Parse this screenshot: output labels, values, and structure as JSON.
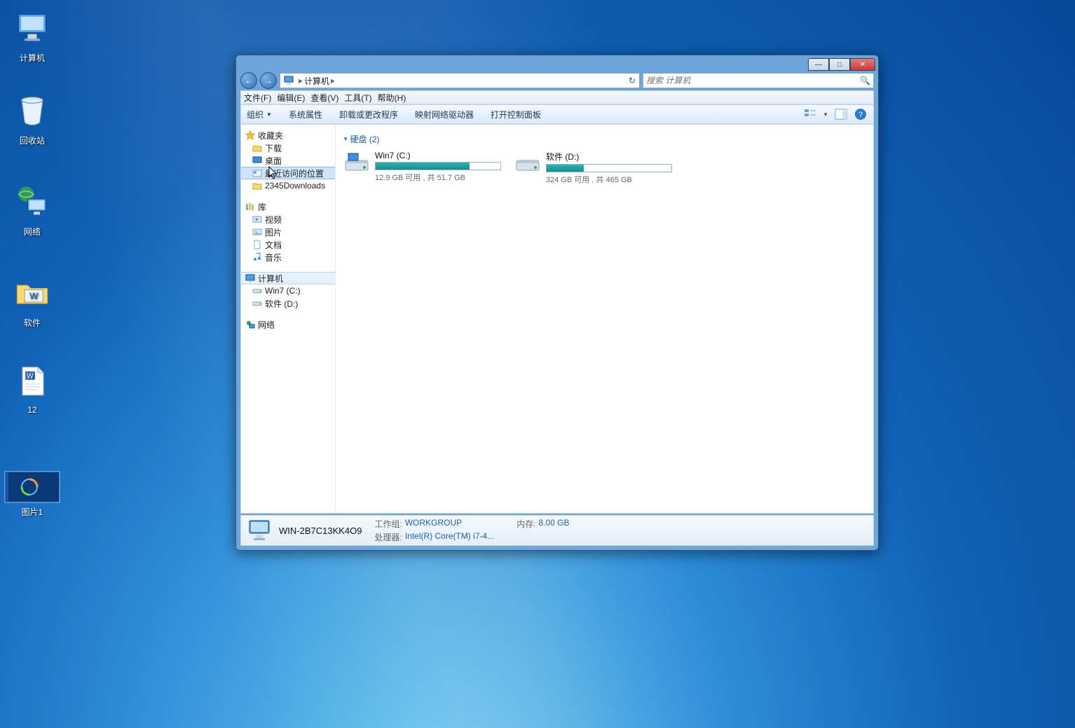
{
  "desktop_icons": [
    {
      "id": "computer",
      "label": "计算机"
    },
    {
      "id": "recycle",
      "label": "回收站"
    },
    {
      "id": "network",
      "label": "网络"
    },
    {
      "id": "software",
      "label": "软件"
    },
    {
      "id": "doc12",
      "label": "12"
    },
    {
      "id": "pic1",
      "label": "图片1"
    }
  ],
  "window": {
    "nav": {
      "back": "←",
      "forward": "→"
    },
    "breadcrumb": {
      "root_sep": "▸",
      "location": "计算机",
      "trail_sep": "▸"
    },
    "search_placeholder": "搜索 计算机",
    "menu": [
      "文件(F)",
      "编辑(E)",
      "查看(V)",
      "工具(T)",
      "帮助(H)"
    ],
    "toolbar": {
      "organize": "组织",
      "items": [
        "系统属性",
        "卸载或更改程序",
        "映射网络驱动器",
        "打开控制面板"
      ]
    },
    "sidebar": {
      "favorites": {
        "title": "收藏夹",
        "items": [
          "下载",
          "桌面",
          "最近访问的位置",
          "2345Downloads"
        ]
      },
      "libraries": {
        "title": "库",
        "items": [
          "视频",
          "图片",
          "文档",
          "音乐"
        ]
      },
      "computer": {
        "title": "计算机",
        "items": [
          "Win7 (C:)",
          "软件 (D:)"
        ]
      },
      "network": {
        "title": "网络"
      }
    },
    "content": {
      "group_label": "硬盘 (2)",
      "drives": [
        {
          "name": "Win7 (C:)",
          "free_text": "12.9 GB 可用 , 共 51.7 GB",
          "used_pct": 75
        },
        {
          "name": "软件 (D:)",
          "free_text": "324 GB 可用 , 共 465 GB",
          "used_pct": 30
        }
      ]
    },
    "status": {
      "name": "WIN-2B7C13KK4O9",
      "workgroup_label": "工作组:",
      "workgroup": "WORKGROUP",
      "memory_label": "内存:",
      "memory": "8.00 GB",
      "cpu_label": "处理器:",
      "cpu": "Intel(R) Core(TM) i7-4..."
    }
  }
}
